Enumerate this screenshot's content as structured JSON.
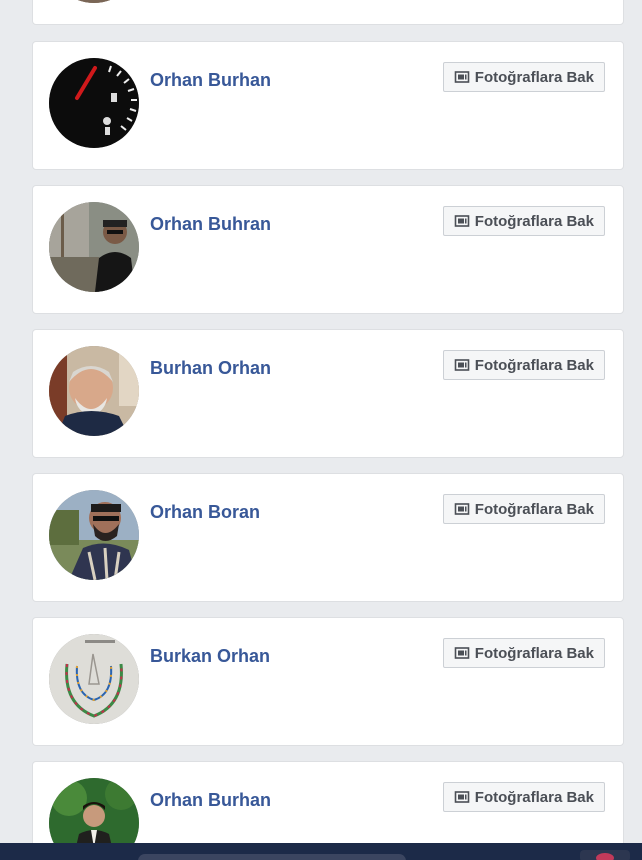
{
  "results": [
    {
      "name": "",
      "button_label": "",
      "avatar": "partial-avatar"
    },
    {
      "name": "Orhan Burhan",
      "button_label": "Fotoğraflara Bak",
      "avatar": "speedometer-photo"
    },
    {
      "name": "Orhan Buhran",
      "button_label": "Fotoğraflara Bak",
      "avatar": "man-sunglasses-cap-photo"
    },
    {
      "name": "Burhan Orhan",
      "button_label": "Fotoğraflara Bak",
      "avatar": "smiling-older-man-photo"
    },
    {
      "name": "Orhan Boran",
      "button_label": "Fotoğraflara Bak",
      "avatar": "man-sunglasses-outdoor-photo"
    },
    {
      "name": "Burkan Orhan",
      "button_label": "Fotoğraflara Bak",
      "avatar": "beaded-necklace-photo"
    },
    {
      "name": "Orhan Burhan",
      "button_label": "Fotoğraflara Bak",
      "avatar": "man-in-green-forest-photo"
    }
  ],
  "icons": {
    "photos_button_icon": "photos-icon"
  },
  "colors": {
    "page_background": "#e9ebee",
    "name_link": "#385898",
    "button_text": "#4b4f56",
    "button_background": "#f5f6f7",
    "taskbar": "#1c2a48"
  }
}
